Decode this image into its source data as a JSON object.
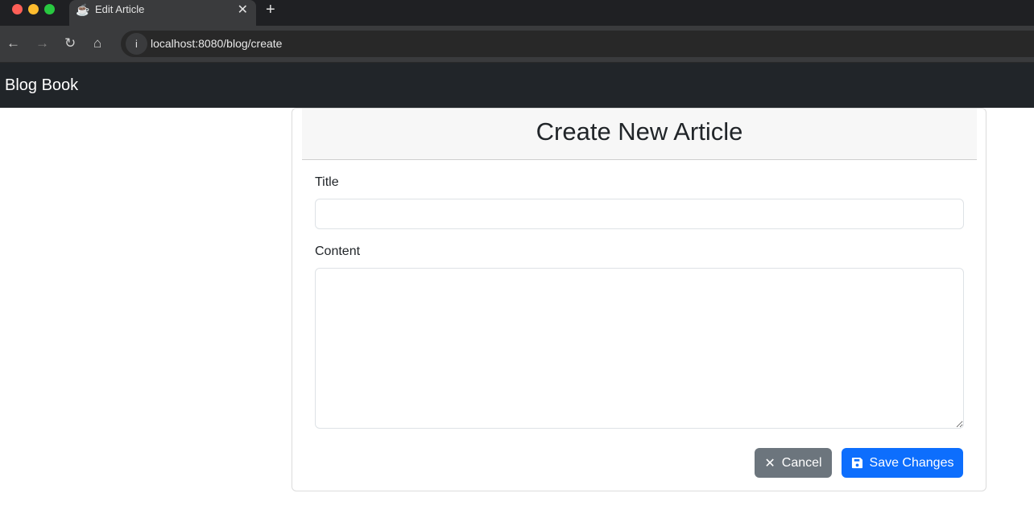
{
  "browser": {
    "tab_title": "Edit Article",
    "url": "localhost:8080/blog/create",
    "colors": {
      "close": "#ff5f57",
      "minimize": "#febc2e",
      "maximize": "#28c840"
    }
  },
  "navbar": {
    "brand": "Blog Book"
  },
  "form": {
    "heading": "Create New Article",
    "title_label": "Title",
    "title_value": "",
    "content_label": "Content",
    "content_value": "",
    "cancel_label": "Cancel",
    "save_label": "Save Changes"
  },
  "colors": {
    "primary": "#0d6efd",
    "secondary": "#6c757d"
  }
}
